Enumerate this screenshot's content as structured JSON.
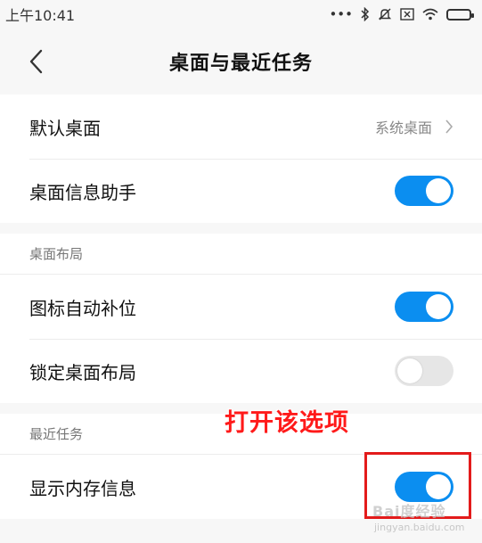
{
  "status_bar": {
    "time": "上午10:41",
    "icons": [
      "more-dots-icon",
      "bluetooth-icon",
      "mute-icon",
      "sim-icon",
      "wifi-icon",
      "battery-icon"
    ]
  },
  "header": {
    "title": "桌面与最近任务",
    "back_icon": "chevron-left-icon"
  },
  "group1": {
    "items": [
      {
        "label": "默认桌面",
        "value": "系统桌面",
        "type": "link"
      },
      {
        "label": "桌面信息助手",
        "type": "toggle",
        "on": true
      }
    ]
  },
  "layout_section": {
    "header": "桌面布局",
    "items": [
      {
        "label": "图标自动补位",
        "type": "toggle",
        "on": true
      },
      {
        "label": "锁定桌面布局",
        "type": "toggle",
        "on": false
      }
    ]
  },
  "recent_section": {
    "header": "最近任务",
    "items": [
      {
        "label": "显示内存信息",
        "type": "toggle",
        "on": true
      }
    ]
  },
  "annotation": {
    "text": "打开该选项"
  },
  "watermark": {
    "text": "Bai度经验",
    "subtext": "jingyan.baidu.com"
  },
  "colors": {
    "toggle_on": "#0b8ef0",
    "toggle_off": "#e6e6e6",
    "annotation": "#ff1a1a",
    "highlight_border": "#e31b1b"
  }
}
